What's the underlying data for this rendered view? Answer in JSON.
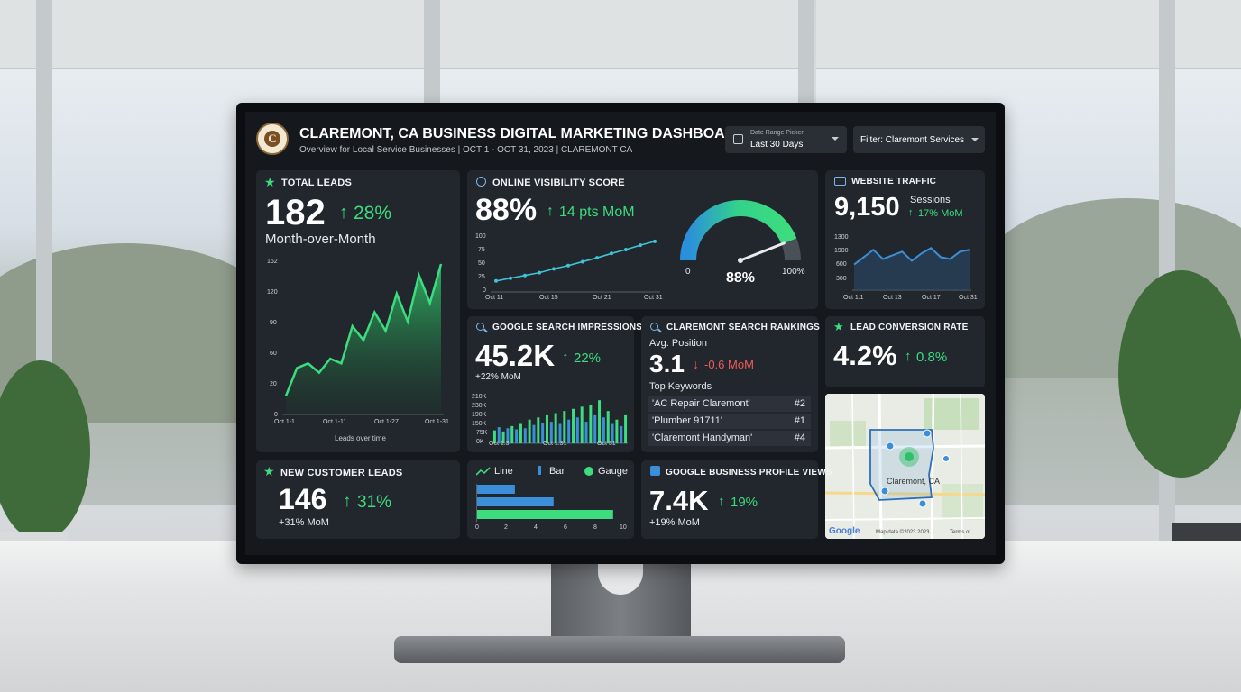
{
  "header": {
    "title": "CLAREMONT, CA BUSINESS DIGITAL MARKETING DASHBOARD",
    "subtitle": "Overview for Local Service Businesses | OCT 1 - OCT 31, 2023 | CLAREMONT CA",
    "date_picker_label": "Date Range Picker",
    "date_picker_value": "Last 30 Days",
    "filter_label": "Filter: Claremont Services"
  },
  "total_leads": {
    "title": "TOTAL LEADS",
    "value": "182",
    "change": "28%",
    "caption": "Month-over-Month",
    "chart_caption": "Leads over time",
    "y_ticks": [
      "162",
      "120",
      "90",
      "60",
      "20",
      "0"
    ],
    "x_ticks": [
      "Oct 1-1",
      "Oct 1-11",
      "Oct 1-27",
      "Oct 1-31"
    ]
  },
  "visibility": {
    "title": "ONLINE VISIBILITY SCORE",
    "value": "88%",
    "change": "14 pts MoM",
    "y_ticks": [
      "100",
      "75",
      "50",
      "25",
      "0"
    ],
    "x_ticks": [
      "Oct 11",
      "Oct 15",
      "Oct 21",
      "Oct 31"
    ],
    "gauge_min": "0",
    "gauge_max": "100%",
    "gauge_value": "88%",
    "gauge_fraction": 0.88
  },
  "traffic": {
    "title": "WEBSITE TRAFFIC",
    "value": "9,150",
    "unit": "Sessions",
    "change": "17% MoM",
    "y_ticks": [
      "1300",
      "1900",
      "600",
      "300"
    ],
    "x_ticks": [
      "Oct 1:1",
      "Oct 13",
      "Oct 17",
      "Oct 31"
    ]
  },
  "impressions": {
    "title": "GOOGLE SEARCH IMPRESSIONS",
    "value": "45.2K",
    "change": "22%",
    "caption": "+22% MoM",
    "y_ticks": [
      "210K",
      "230K",
      "190K",
      "150K",
      "75K",
      "0K"
    ],
    "x_ticks": [
      "Oct 1:3",
      "Oct 1:31",
      "Oct 31"
    ]
  },
  "rankings": {
    "title": "CLAREMONT SEARCH RANKINGS",
    "avg_label": "Avg. Position",
    "value": "3.1",
    "change": "-0.6 MoM",
    "keywords_label": "Top Keywords",
    "keywords": [
      {
        "term": "'AC Repair Claremont'",
        "rank": "#2"
      },
      {
        "term": "'Plumber 91711'",
        "rank": "#1"
      },
      {
        "term": "'Claremont Handyman'",
        "rank": "#4"
      }
    ]
  },
  "conversion": {
    "title": "LEAD CONVERSION RATE",
    "value": "4.2%",
    "change": "0.8%"
  },
  "map": {
    "city_label": "Claremont, CA",
    "attribution": "Map data ©2023 2023",
    "terms": "Terms of",
    "logo": "Google"
  },
  "new_leads": {
    "title": "NEW CUSTOMER LEADS",
    "value": "146",
    "change": "31%",
    "caption": "+31% MoM"
  },
  "legend_card": {
    "legend": [
      "Line",
      "Bar",
      "Gauge"
    ],
    "x_ticks": [
      "0",
      "2",
      "4",
      "6",
      "8",
      "10"
    ]
  },
  "gbp": {
    "title": "GOOGLE BUSINESS PROFILE VIEWS",
    "value": "7.4K",
    "change": "19%",
    "caption": "+19% MoM"
  },
  "colors": {
    "green": "#3ddc7e",
    "blue": "#3b8fd9",
    "red": "#ef5a5a",
    "card": "#22262d",
    "screen": "#15181d"
  },
  "chart_data": [
    {
      "type": "area",
      "title": "TOTAL LEADS",
      "xlabel": "Leads over time",
      "x": [
        "Oct 1-1",
        "Oct 1-11",
        "Oct 1-27",
        "Oct 1-31"
      ],
      "values": [
        20,
        50,
        55,
        45,
        60,
        55,
        95,
        80,
        110,
        90,
        130,
        100,
        150,
        120,
        162
      ],
      "ylim": [
        0,
        162
      ]
    },
    {
      "type": "line",
      "title": "ONLINE VISIBILITY SCORE",
      "values": [
        20,
        25,
        30,
        35,
        42,
        48,
        55,
        62,
        70,
        77,
        85,
        92
      ],
      "ylim": [
        0,
        100
      ]
    },
    {
      "type": "line",
      "title": "WEBSITE TRAFFIC",
      "values": [
        700,
        900,
        1100,
        850,
        950,
        1050,
        800,
        1000,
        1150,
        900,
        850,
        1050,
        1100
      ],
      "ylim": [
        0,
        1500
      ]
    },
    {
      "type": "bar",
      "title": "GOOGLE SEARCH IMPRESSIONS",
      "values": [
        60,
        75,
        55,
        70,
        80,
        65,
        90,
        70,
        110,
        85,
        120,
        95,
        130,
        100,
        140,
        90,
        150,
        110,
        160,
        120,
        170,
        100,
        180,
        130,
        200,
        120,
        150,
        90,
        110,
        80,
        130
      ],
      "ylim": [
        0,
        230
      ]
    },
    {
      "type": "bar",
      "orientation": "horizontal",
      "values": [
        2.6,
        5.2,
        9.2
      ],
      "xlim": [
        0,
        10
      ]
    }
  ]
}
